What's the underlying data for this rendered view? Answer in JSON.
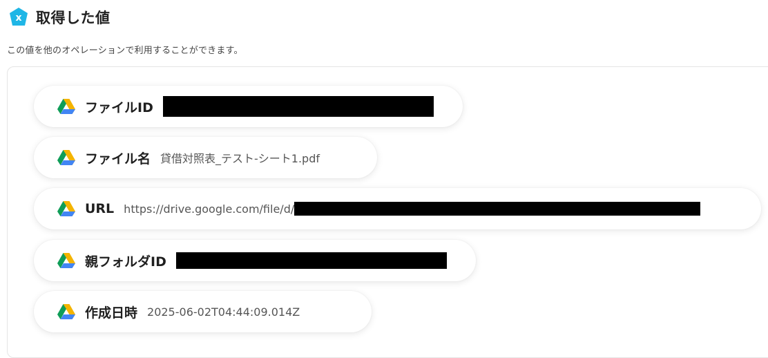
{
  "header": {
    "title": "取得した値",
    "subtitle": "この値を他のオペレーションで利用することができます。"
  },
  "fields": {
    "file_id": {
      "label": "ファイルID",
      "value": ""
    },
    "file_name": {
      "label": "ファイル名",
      "value": "貸借対照表_テスト-シート1.pdf"
    },
    "url": {
      "label": "URL",
      "value": "https://drive.google.com/file/d/"
    },
    "parent_folder_id": {
      "label": "親フォルダID",
      "value": ""
    },
    "created_at": {
      "label": "作成日時",
      "value": "2025-06-02T04:44:09.014Z"
    }
  },
  "icons": {
    "header_badge": "yoom-badge-icon",
    "row_icon": "google-drive-icon"
  },
  "colors": {
    "badge": "#1fb6e6",
    "drive_green": "#0f9d58",
    "drive_yellow": "#f4b400",
    "drive_blue": "#4285f4",
    "drive_red": "#db4437",
    "redaction": "#000000"
  }
}
